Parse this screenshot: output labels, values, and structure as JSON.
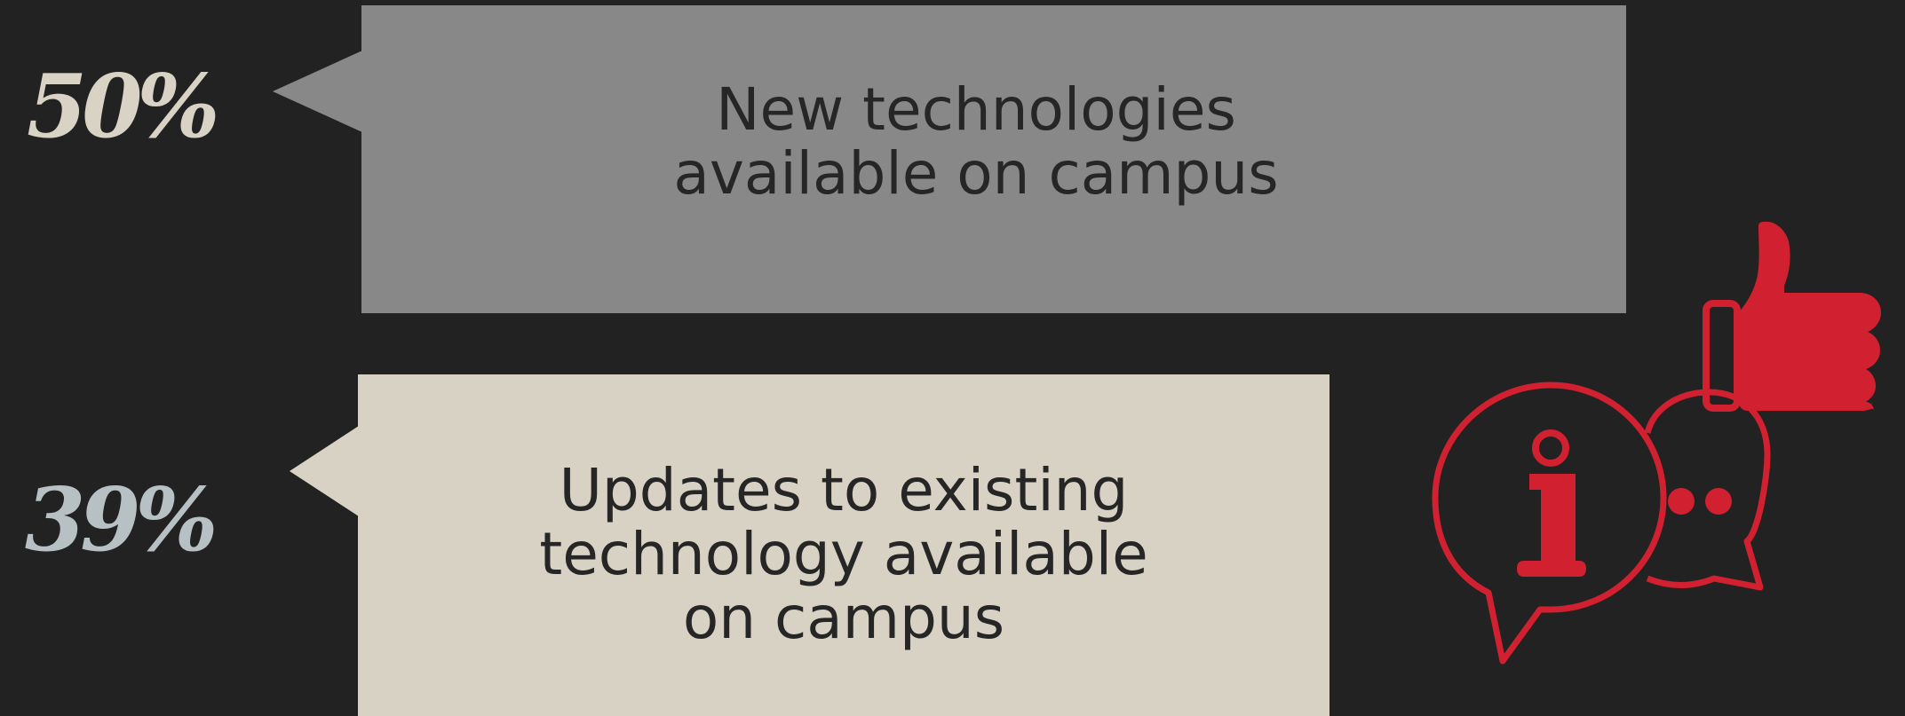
{
  "stats": [
    {
      "percent": "50%",
      "label": "New technologies\navailable on campus"
    },
    {
      "percent": "39%",
      "label": "Updates to existing\ntechnology available\non campus"
    }
  ],
  "icons": {
    "thumbs_up": "thumbs-up-icon",
    "chat_info": "info-speech-bubble-icon"
  },
  "colors": {
    "background": "#222222",
    "bubble_1": "#888888",
    "bubble_2": "#d7d2c3",
    "accent_red": "#d12030",
    "stat_1": "#d8d3c4",
    "stat_2": "#b7c0c3"
  }
}
